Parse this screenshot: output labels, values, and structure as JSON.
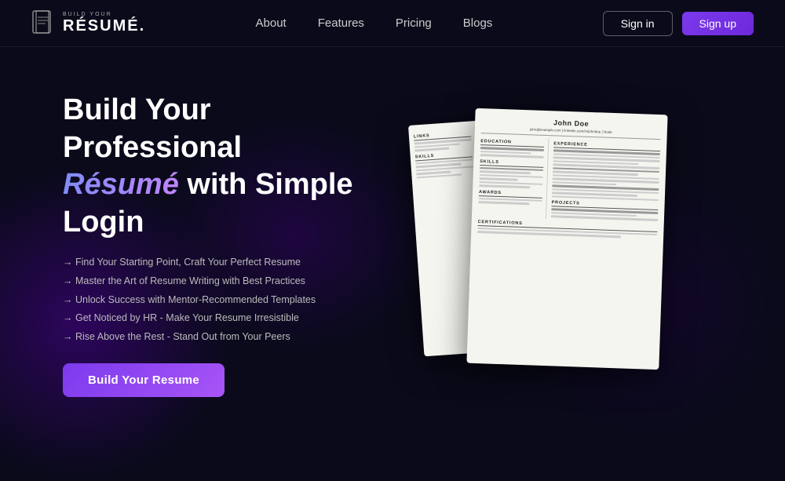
{
  "meta": {
    "title": "Build Your Resume"
  },
  "logo": {
    "build": "BUILD YOUR",
    "resume": "RÉSUMÉ."
  },
  "nav": {
    "links": [
      {
        "label": "About",
        "id": "about"
      },
      {
        "label": "Features",
        "id": "features"
      },
      {
        "label": "Pricing",
        "id": "pricing"
      },
      {
        "label": "Blogs",
        "id": "blogs"
      }
    ],
    "signin": "Sign in",
    "signup": "Sign up"
  },
  "hero": {
    "title_part1": "Build Your Professional",
    "title_highlight": "Résumé",
    "title_part2": " with Simple Login",
    "bullets": [
      "→ Find Your Starting Point, Craft Your Perfect Resume",
      "→ Master the Art of Resume Writing with Best Practices",
      "→ Unlock Success with Mentor-Recommended Templates",
      "→ Get Noticed by HR - Make Your Resume Irresistible",
      "→ Rise Above the Rest - Stand Out from Your Peers"
    ],
    "cta": "Build Your Resume"
  },
  "resume_preview": {
    "name": "John Doe",
    "contact": "john@example.com  |  linkedin.com/in/johndoe  |  Node"
  }
}
